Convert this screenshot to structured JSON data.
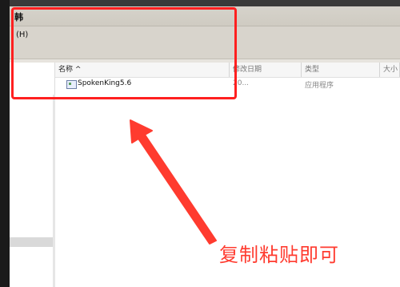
{
  "window": {
    "title": "韩"
  },
  "menu": {
    "help_label": "(H)"
  },
  "file_list": {
    "columns": [
      "名称 ^",
      "修改日期",
      "类型",
      "大小"
    ],
    "rows": [
      {
        "name": "SpokenKing5.6",
        "date": "20... ",
        "type": "应用程序"
      }
    ]
  },
  "annotation": {
    "caption": "复制粘贴即可"
  },
  "colors": {
    "highlight": "#ff2020",
    "caption": "#ff3b2f"
  }
}
